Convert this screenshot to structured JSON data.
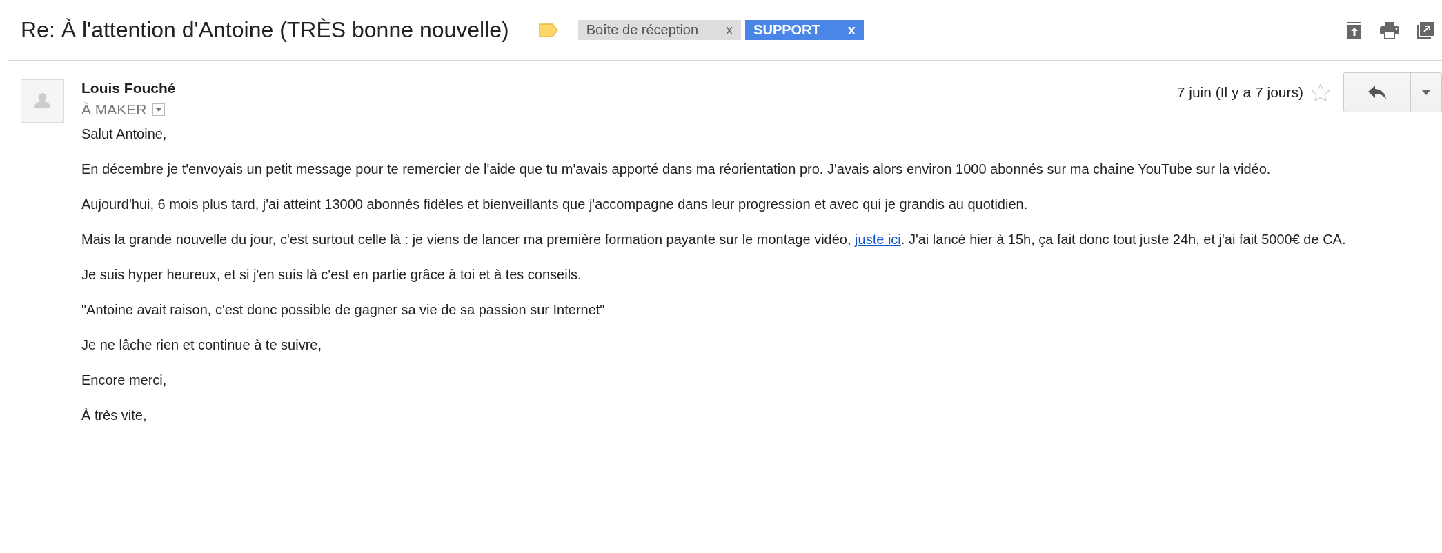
{
  "subject": "Re: À l'attention d'Antoine (TRÈS bonne nouvelle)",
  "labels": [
    {
      "text": "Boîte de réception",
      "color": "#dddddd",
      "remove": "x"
    },
    {
      "text": "SUPPORT",
      "color": "#4a86e8",
      "remove": "x"
    }
  ],
  "sender": {
    "name": "Louis Fouché",
    "recipient": "À MAKER",
    "date": "7 juin (Il y a 7 jours)",
    "starred": false
  },
  "body": [
    {
      "parts": [
        {
          "text": "Salut Antoine,"
        }
      ]
    },
    {
      "parts": [
        {
          "text": "En décembre je t'envoyais un petit message pour te remercier de l'aide que tu m'avais apporté dans ma réorientation pro. J'avais alors environ 1000 abonnés sur ma chaîne YouTube sur la vidéo."
        }
      ]
    },
    {
      "parts": [
        {
          "text": "Aujourd'hui, 6 mois plus tard, j'ai atteint 13000 abonnés fidèles et bienveillants que j'accompagne dans leur progression et avec qui je grandis au quotidien."
        }
      ]
    },
    {
      "parts": [
        {
          "text": "Mais la grande nouvelle du jour, c'est surtout celle là : je viens de lancer ma première formation payante sur le montage vidéo, "
        },
        {
          "text": "juste ici",
          "kind": "link"
        },
        {
          "text": ". J'ai lancé hier à 15h, ça fait donc tout juste 24h, et j'ai fait 5000€ de CA."
        }
      ]
    },
    {
      "parts": [
        {
          "text": "Je suis hyper heureux, et si j'en suis là c'est en partie grâce à toi et à tes conseils."
        }
      ]
    },
    {
      "parts": [
        {
          "text": "\"Antoine avait raison, c'est donc possible de gagner sa vie de sa passion sur Internet\""
        }
      ]
    },
    {
      "parts": [
        {
          "text": "Je ne lâche rien et continue à te suivre,"
        }
      ]
    },
    {
      "parts": [
        {
          "text": "Encore merci,"
        }
      ]
    },
    {
      "parts": [
        {
          "text": "À très vite,"
        }
      ]
    }
  ]
}
